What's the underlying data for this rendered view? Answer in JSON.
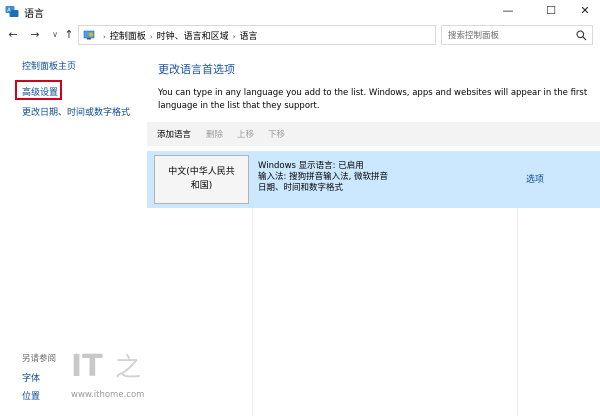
{
  "window": {
    "title": "语言",
    "minimize_glyph": "—",
    "maximize_glyph": "☐",
    "close_glyph": "✕"
  },
  "nav": {
    "back_glyph": "←",
    "forward_glyph": "→",
    "dropdown_glyph": "∨",
    "up_glyph": "↑"
  },
  "address": {
    "breadcrumbs": [
      "控制面板",
      "时钟、语言和区域",
      "语言"
    ],
    "separator_glyph": "›",
    "dropdown_glyph": "∨",
    "refresh_glyph": "↻"
  },
  "search": {
    "placeholder": "搜索控制面板"
  },
  "sidebar": {
    "home": "控制面板主页",
    "advanced": "高级设置",
    "datetime": "更改日期、时间或数字格式",
    "see_also_label": "另请参阅",
    "font": "字体",
    "location": "位置"
  },
  "main": {
    "heading": "更改语言首选项",
    "description": "You can type in any language you add to the list. Windows, apps and websites will appear in the first language in the list that they support.",
    "toolbar": {
      "add": "添加语言",
      "remove": "删除",
      "move_up": "上移",
      "move_down": "下移"
    },
    "languages": [
      {
        "name_line1": "中文(中华人民共",
        "name_line2": "和国)",
        "info_line1": "Windows 显示语言: 已启用",
        "info_line2": "输入法: 搜狗拼音输入法, 微软拼音",
        "info_line3": "日期、时间和数字格式",
        "options": "选项"
      }
    ]
  },
  "watermark": {
    "logo": "IT之家",
    "url": "www.ithome.com"
  },
  "colors": {
    "link": "#0d4c91",
    "heading": "#1a56a5",
    "selected_row": "#cce8ff",
    "toolbar_bg": "#f3f3f3",
    "highlight_box": "#d0021b"
  },
  "icons": {
    "app": "control-panel-icon",
    "search": "search-icon",
    "address": "control-panel-icon"
  }
}
